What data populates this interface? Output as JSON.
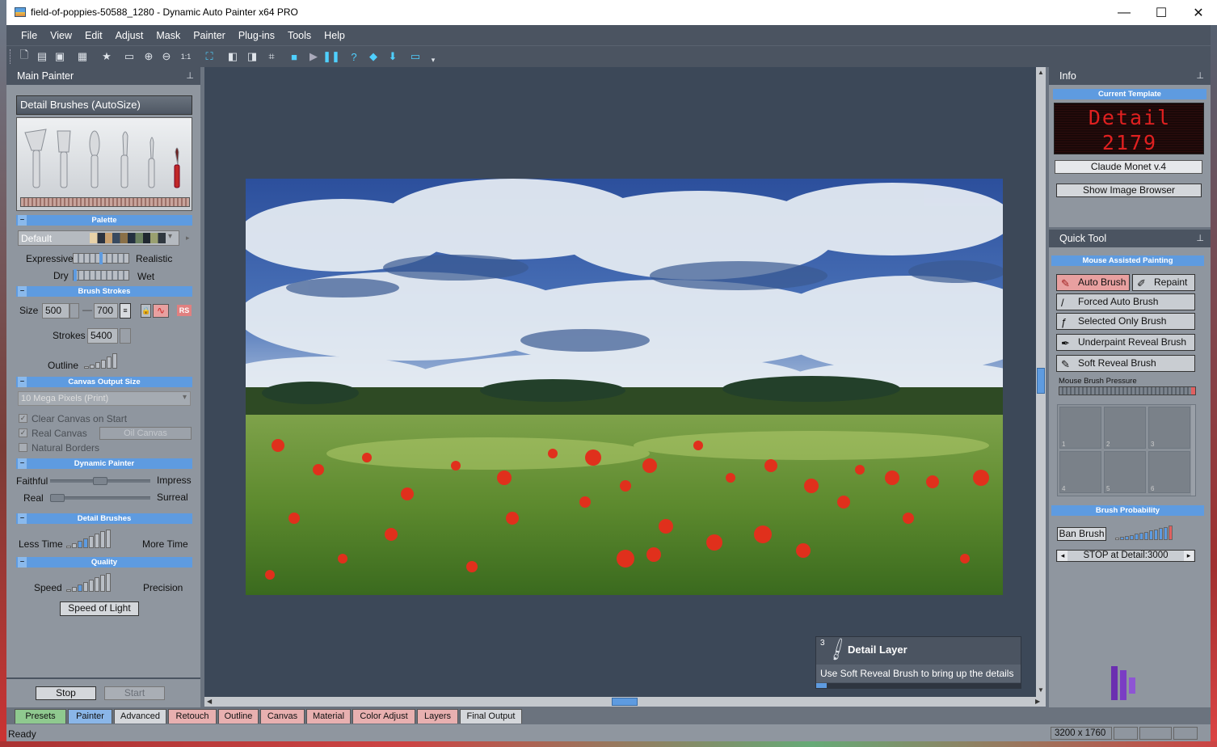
{
  "window": {
    "title": "field-of-poppies-50588_1280 - Dynamic Auto Painter x64 PRO",
    "minimize": "—",
    "maximize": "☐",
    "close": "✕"
  },
  "menu": [
    "File",
    "View",
    "Edit",
    "Adjust",
    "Mask",
    "Painter",
    "Plug-ins",
    "Tools",
    "Help"
  ],
  "toolbar": {
    "icons": [
      "new-icon",
      "open-icon",
      "save-icon",
      "save-as-icon",
      "favorite-icon",
      "load-icon",
      "zoom-in-icon",
      "zoom-out-icon",
      "zoom-1-1-icon",
      "fit-icon",
      "crop-layer-icon",
      "compare-icon",
      "crop-icon",
      "stop-icon",
      "play-icon",
      "pause-icon",
      "help-icon",
      "layers-icon",
      "download-icon",
      "screen-icon"
    ],
    "zoom_label": "1:1"
  },
  "left_panel": {
    "header": "Main Painter",
    "template_name": "Detail Brushes (AutoSize)",
    "palette": {
      "section": "Palette",
      "value": "Default",
      "expressive": "Expressive",
      "realistic": "Realistic",
      "dry": "Dry",
      "wet": "Wet"
    },
    "brush_strokes": {
      "section": "Brush Strokes",
      "size_label": "Size",
      "size_min": "500",
      "size_dash": "—",
      "size_max": "700",
      "strokes_label": "Strokes",
      "strokes": "5400",
      "outline_label": "Outline",
      "rs_badge": "RS"
    },
    "canvas_output": {
      "section": "Canvas Output Size",
      "value": "10 Mega Pixels (Print)",
      "clear_canvas": "Clear Canvas on Start",
      "real_canvas": "Real Canvas",
      "canvas_type": "Oil Canvas",
      "natural_borders": "Natural Borders"
    },
    "dynamic_painter": {
      "section": "Dynamic Painter",
      "faithful": "Faithful",
      "impress": "Impress",
      "real": "Real",
      "surreal": "Surreal"
    },
    "detail_brushes": {
      "section": "Detail Brushes",
      "less_time": "Less Time",
      "more_time": "More Time"
    },
    "quality": {
      "section": "Quality",
      "speed": "Speed",
      "precision": "Precision",
      "preset_button": "Speed of Light"
    },
    "stop_button": "Stop",
    "start_button": "Start"
  },
  "canvas": {
    "hint": {
      "step": "3",
      "title": "Detail Layer",
      "text": "Use Soft Reveal Brush to bring up the details"
    }
  },
  "right_panel": {
    "info_header": "Info",
    "current_template_label": "Current Template",
    "led_line1": "Detail",
    "led_line2": "2179",
    "style_name": "Claude Monet v.4",
    "show_image_browser": "Show Image Browser",
    "quick_tool_header": "Quick Tool",
    "mouse_assisted": "Mouse Assisted Painting",
    "auto_brush": "Auto Brush",
    "repaint": "Repaint",
    "forced_auto_brush": "Forced Auto Brush",
    "selected_only_brush": "Selected Only Brush",
    "underpaint_reveal_brush": "Underpaint Reveal Brush",
    "soft_reveal_brush": "Soft Reveal Brush",
    "mouse_brush_pressure": "Mouse Brush Pressure",
    "brush_slots": [
      "1",
      "2",
      "3",
      "4",
      "5",
      "6"
    ],
    "brush_probability": "Brush Probability",
    "ban_brush": "Ban Brush",
    "stop_at_detail": "STOP at Detail:3000",
    "prev_arrow": "◂",
    "next_arrow": "▸"
  },
  "tabs": [
    "Presets",
    "Painter",
    "Advanced",
    "Retouch",
    "Outline",
    "Canvas",
    "Material",
    "Color Adjust",
    "Layers",
    "Final Output"
  ],
  "status": {
    "text": "Ready",
    "dimensions": "3200 x 1760"
  },
  "colors": {
    "panel_bg": "#8f969f",
    "dark_bg": "#4b5461",
    "canvas_bg": "#3c4858",
    "section_blue": "#5e9be0",
    "led_red": "#e02020",
    "accent_purple": "#6b2fb0"
  }
}
